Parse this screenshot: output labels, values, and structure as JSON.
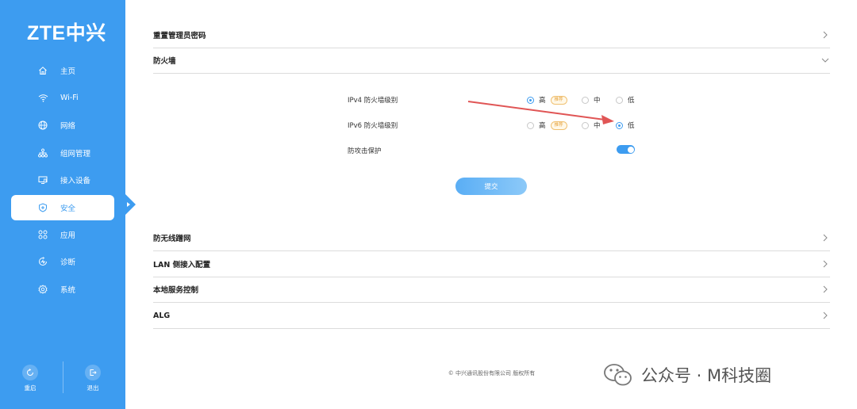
{
  "brand": {
    "logo_text": "ZTE中兴"
  },
  "sidebar": {
    "items": [
      {
        "label": "主页",
        "icon": "home-icon"
      },
      {
        "label": "Wi-Fi",
        "icon": "wifi-icon"
      },
      {
        "label": "网络",
        "icon": "globe-icon"
      },
      {
        "label": "组网管理",
        "icon": "network-tree-icon"
      },
      {
        "label": "接入设备",
        "icon": "device-icon"
      },
      {
        "label": "安全",
        "icon": "shield-icon",
        "active": true
      },
      {
        "label": "应用",
        "icon": "apps-icon"
      },
      {
        "label": "诊断",
        "icon": "diagnose-icon"
      },
      {
        "label": "系统",
        "icon": "gear-icon"
      }
    ],
    "bottom": {
      "restart_label": "重启",
      "logout_label": "退出"
    }
  },
  "sections": {
    "admin_password": "重置管理员密码",
    "firewall": "防火墙",
    "anti_wireless": "防无线蹭网",
    "lan_access": "LAN 侧接入配置",
    "local_service": "本地服务控制",
    "alg": "ALG"
  },
  "firewall": {
    "ipv4_label": "IPv4 防火墙级别",
    "ipv6_label": "IPv6 防火墙级别",
    "attack_label": "防攻击保护",
    "level_high": "高",
    "level_mid": "中",
    "level_low": "低",
    "recommended_badge": "推荐",
    "ipv4_selected": "高",
    "ipv6_selected": "低",
    "attack_protection_on": true,
    "submit_label": "提交"
  },
  "footer": {
    "copyright": "© 中兴通讯股份有限公司 版权所有"
  },
  "watermark": {
    "text": "公众号 · M科技圈"
  },
  "colors": {
    "accent": "#3d9cf0",
    "annotation": "#e05555",
    "badge": "#e6a23c"
  }
}
